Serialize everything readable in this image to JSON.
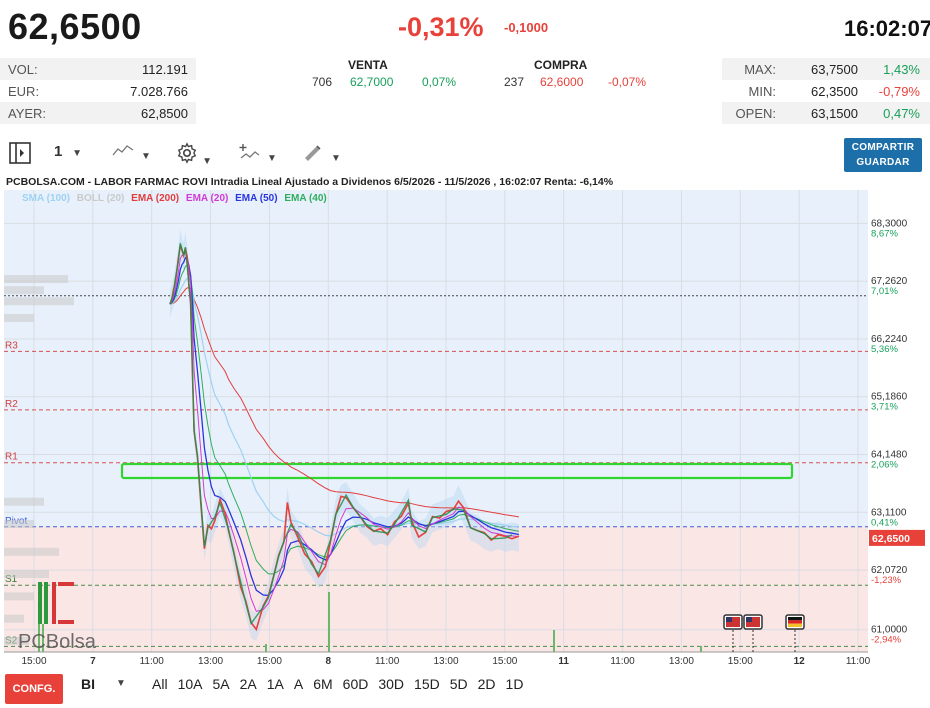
{
  "header": {
    "price": "62,6500",
    "change_pct": "-0,31%",
    "change_abs": "-0,1000",
    "time": "16:02:07"
  },
  "stats_left": [
    {
      "label": "VOL:",
      "value": "112.191"
    },
    {
      "label": "EUR:",
      "value": "7.028.766"
    },
    {
      "label": "AYER:",
      "value": "62,8500"
    }
  ],
  "order_book": {
    "sell": {
      "label": "VENTA",
      "qty": "706",
      "price": "62,7000",
      "pct": "0,07%"
    },
    "buy": {
      "label": "COMPRA",
      "qty": "237",
      "price": "62,6000",
      "pct": "-0,07%"
    }
  },
  "stats_right": [
    {
      "label": "MAX:",
      "value": "63,7500",
      "pct": "1,43%"
    },
    {
      "label": "MIN:",
      "value": "62,3500",
      "pct": "-0,79%"
    },
    {
      "label": "OPEN:",
      "value": "63,1500",
      "pct": "0,47%"
    }
  ],
  "toolbar": {
    "period_value": "1",
    "share_label": "COMPARTIR",
    "save_label": "GUARDAR"
  },
  "chart": {
    "title": "PCBOLSA.COM - LABOR FARMAC ROVI Intradia Lineal Ajustado a Dividenos 6/5/2026 - 11/5/2026 , 16:02:07 Renta: -6,14%",
    "watermark": "PCBolsa",
    "legend": [
      {
        "label": "SMA (100)",
        "color": "#9fd1f2"
      },
      {
        "label": "BOLL (20)",
        "color": "#c9c9c9"
      },
      {
        "label": "EMA (200)",
        "color": "#e23d3d"
      },
      {
        "label": "EMA (20)",
        "color": "#d23ad6"
      },
      {
        "label": "EMA (50)",
        "color": "#2a35e0"
      },
      {
        "label": "EMA (40)",
        "color": "#2fae5e"
      }
    ],
    "current_price_tag": "62,6500"
  },
  "chart_data": {
    "type": "line",
    "y_axis": [
      {
        "value": "68,3000",
        "pct": "8,67%"
      },
      {
        "value": "67,2620",
        "pct": "7,01%"
      },
      {
        "value": "66,2240",
        "pct": "5,36%"
      },
      {
        "value": "65,1860",
        "pct": "3,71%"
      },
      {
        "value": "64,1480",
        "pct": "2,06%"
      },
      {
        "value": "63,1100",
        "pct": "0,41%"
      },
      {
        "value": "62,0720",
        "pct": "-1,23%"
      },
      {
        "value": "61,0000",
        "pct": "-2,94%"
      }
    ],
    "x_ticks": [
      "15:00",
      "7",
      "11:00",
      "13:00",
      "15:00",
      "8",
      "11:00",
      "13:00",
      "15:00",
      "11",
      "11:00",
      "13:00",
      "15:00",
      "12",
      "11:00"
    ],
    "pivot_levels": [
      {
        "name": "R3",
        "value": 66.0
      },
      {
        "name": "R2",
        "value": 64.95
      },
      {
        "name": "R1",
        "value": 64.0
      },
      {
        "name": "Pivot",
        "value": 62.85
      },
      {
        "name": "S1",
        "value": 61.8
      },
      {
        "name": "S2",
        "value": 60.7
      }
    ],
    "ylim": [
      60.6,
      68.9
    ],
    "x_days": [
      6,
      11
    ],
    "price_series": [
      [
        6.96,
        66.85
      ],
      [
        6.97,
        66.95
      ],
      [
        6.98,
        67.05
      ],
      [
        6.99,
        67.25
      ],
      [
        7.0,
        67.45
      ],
      [
        7.01,
        67.65
      ],
      [
        7.02,
        67.95
      ],
      [
        7.03,
        67.8
      ],
      [
        7.04,
        67.7
      ],
      [
        7.05,
        67.9
      ],
      [
        7.06,
        67.65
      ],
      [
        7.07,
        67.2
      ],
      [
        7.08,
        66.9
      ],
      [
        7.09,
        65.6
      ],
      [
        7.1,
        64.6
      ],
      [
        7.12,
        64.1
      ],
      [
        7.14,
        63.2
      ],
      [
        7.16,
        62.5
      ],
      [
        7.18,
        62.85
      ],
      [
        7.2,
        62.8
      ],
      [
        7.22,
        63.0
      ],
      [
        7.25,
        63.3
      ],
      [
        7.28,
        63.1
      ],
      [
        7.3,
        62.8
      ],
      [
        7.33,
        62.35
      ],
      [
        7.37,
        61.8
      ],
      [
        7.4,
        61.5
      ],
      [
        7.43,
        61.1
      ],
      [
        7.46,
        61.05
      ],
      [
        7.5,
        61.4
      ],
      [
        7.53,
        61.6
      ],
      [
        7.56,
        62.0
      ],
      [
        7.59,
        62.3
      ],
      [
        7.62,
        62.6
      ],
      [
        7.64,
        63.3
      ],
      [
        7.66,
        62.9
      ],
      [
        7.7,
        62.7
      ],
      [
        7.74,
        62.35
      ],
      [
        7.78,
        62.2
      ],
      [
        7.82,
        62.0
      ],
      [
        7.86,
        62.1
      ],
      [
        7.89,
        62.6
      ],
      [
        7.92,
        63.1
      ],
      [
        7.95,
        63.35
      ],
      [
        7.98,
        63.4
      ],
      [
        8.02,
        63.2
      ],
      [
        8.06,
        63.0
      ],
      [
        8.1,
        62.9
      ],
      [
        8.14,
        62.75
      ],
      [
        8.18,
        62.8
      ],
      [
        8.22,
        62.75
      ],
      [
        8.26,
        62.9
      ],
      [
        8.3,
        63.05
      ],
      [
        8.34,
        63.3
      ],
      [
        8.36,
        62.9
      ],
      [
        8.4,
        62.7
      ],
      [
        8.44,
        62.75
      ],
      [
        8.48,
        63.0
      ],
      [
        8.52,
        63.05
      ],
      [
        8.56,
        63.1
      ],
      [
        8.6,
        63.15
      ],
      [
        8.63,
        63.35
      ],
      [
        8.66,
        63.15
      ],
      [
        8.7,
        62.85
      ],
      [
        8.74,
        62.8
      ],
      [
        8.78,
        62.7
      ],
      [
        8.82,
        62.65
      ],
      [
        8.86,
        62.7
      ],
      [
        8.9,
        62.65
      ],
      [
        8.94,
        62.68
      ],
      [
        8.98,
        62.65
      ]
    ]
  },
  "bottom_bar": {
    "config_label": "CONFG.",
    "bi_label": "BI",
    "periods": [
      "All",
      "10A",
      "5A",
      "2A",
      "1A",
      "A",
      "6M",
      "60D",
      "30D",
      "15D",
      "5D",
      "2D",
      "1D"
    ]
  }
}
